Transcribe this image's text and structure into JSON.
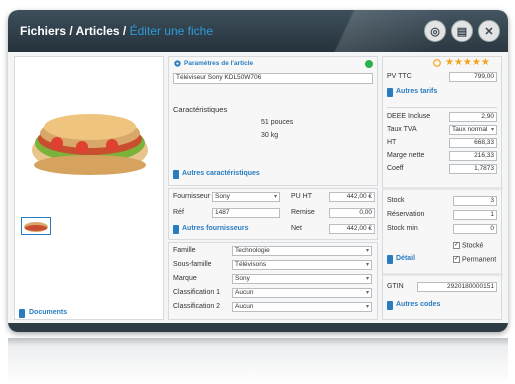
{
  "breadcrumb": {
    "part1": "Fichiers / Articles / ",
    "current": "Éditer une fiche"
  },
  "toolbar": {
    "btn1": "◎",
    "btn2": "▤",
    "btn3": "✕"
  },
  "left": {
    "documents": "Documents"
  },
  "params": {
    "title": "Paramètres de l'article",
    "name": "Téléviseur Sony KDL50W706",
    "caract_label": "Caractéristiques",
    "caract1": "51 pouces",
    "caract2": "30 kg",
    "autres_caract": "Autres caractéristiques"
  },
  "supplier": {
    "fournisseur_label": "Fournisseur",
    "fournisseur": "Sony",
    "ref_label": "Réf",
    "ref": "1487",
    "autres": "Autres fournisseurs",
    "puht_label": "PU HT",
    "puht": "442,00 €",
    "remise_label": "Remise",
    "remise": "0,00",
    "net_label": "Net",
    "net": "442,00 €"
  },
  "classif": {
    "famille_label": "Famille",
    "famille": "Technologie",
    "sousfam_label": "Sous-famille",
    "sousfam": "Télévisons",
    "marque_label": "Marque",
    "marque": "Sony",
    "c1_label": "Classification 1",
    "c1": "Aucun",
    "c2_label": "Classification 2",
    "c2": "Aucun"
  },
  "pricing": {
    "rating_stars": "★★★★★",
    "pvttc_label": "PV TTC",
    "pvttc": "799,00",
    "autres_tarifs": "Autres tarifs",
    "deee_label": "DEEE Incluse",
    "deee": "2,90",
    "tva_label": "Taux TVA",
    "tva": "Taux normal",
    "ht_label": "HT",
    "ht": "668,33",
    "marge_label": "Marge nette",
    "marge": "216,33",
    "coeff_label": "Coeff",
    "coeff": "1,7873"
  },
  "stock": {
    "stock_label": "Stock",
    "stock": "3",
    "reserv_label": "Réservation",
    "reserv": "1",
    "min_label": "Stock min",
    "min": "0",
    "stocke": "Stocké",
    "permanent": "Permanent",
    "detail": "Détail"
  },
  "codes": {
    "gtin_label": "GTIN",
    "gtin": "2920180000151",
    "autres": "Autres codes"
  },
  "colors": {
    "titlebar": "#2c3a44",
    "accent": "#2f9bd6",
    "link": "#2a7cc0",
    "status_dot": "#2ab34a",
    "stars": "#f2a51d"
  },
  "icons": [
    "settings-icon",
    "save-icon",
    "close-icon",
    "gear-icon",
    "book-icon",
    "status-dot-icon",
    "star-rating-icon"
  ]
}
